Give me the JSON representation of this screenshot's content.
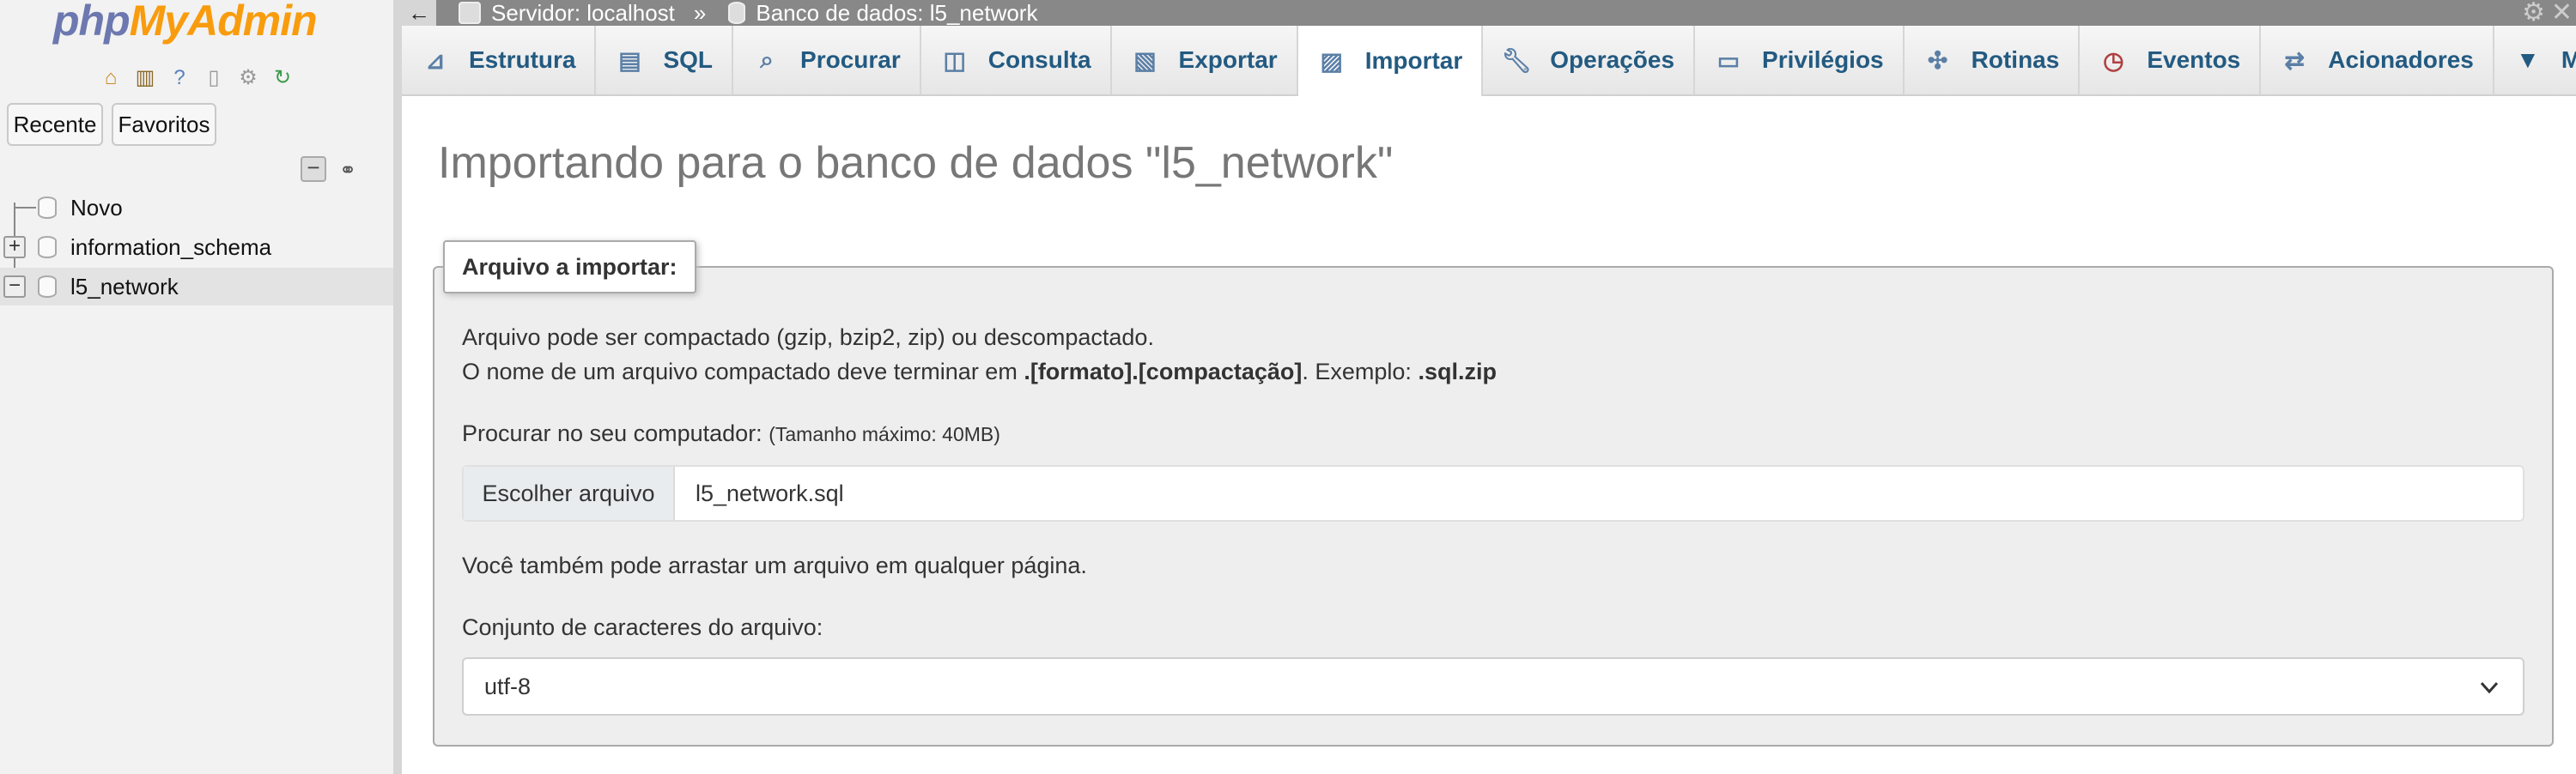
{
  "nav": {
    "logo": {
      "php": "php",
      "my": "My",
      "admin": "Admin"
    },
    "icons": [
      "home-icon",
      "logout-icon",
      "help-icon",
      "docs-icon",
      "settings-icon",
      "reload-icon"
    ],
    "tabs": {
      "recent": "Recente",
      "favorites": "Favoritos"
    },
    "tree": [
      {
        "label": "Novo"
      },
      {
        "label": "information_schema"
      },
      {
        "label": "l5_network"
      }
    ]
  },
  "topbar": {
    "back": "←",
    "server": "Servidor: localhost",
    "separator": "»",
    "database": "Banco de dados: l5_network"
  },
  "menu": {
    "tabs": [
      {
        "label": "Estrutura",
        "icon": "structure-icon"
      },
      {
        "label": "SQL",
        "icon": "sql-icon"
      },
      {
        "label": "Procurar",
        "icon": "search-icon"
      },
      {
        "label": "Consulta",
        "icon": "query-icon"
      },
      {
        "label": "Exportar",
        "icon": "export-icon"
      },
      {
        "label": "Importar",
        "icon": "import-icon",
        "active": true
      },
      {
        "label": "Operações",
        "icon": "wrench-icon"
      },
      {
        "label": "Privilégios",
        "icon": "privileges-icon"
      },
      {
        "label": "Rotinas",
        "icon": "routines-icon"
      },
      {
        "label": "Eventos",
        "icon": "events-icon"
      },
      {
        "label": "Acionadores",
        "icon": "triggers-icon"
      },
      {
        "label": "Mais",
        "icon": "caret-down-icon"
      }
    ]
  },
  "page": {
    "title": "Importando para o banco de dados \"l5_network\"",
    "legend": "Arquivo a importar:",
    "line1": "Arquivo pode ser compactado (gzip, bzip2, zip) ou descompactado.",
    "line2_pre": "O nome de um arquivo compactado deve terminar em ",
    "line2_bold": ".[formato].[compactação]",
    "line2_mid": ". Exemplo: ",
    "line2_example": ".sql.zip",
    "browse_label": "Procurar no seu computador:",
    "max_size": "(Tamanho máximo: 40MB)",
    "choose_button": "Escolher arquivo",
    "file_name": "l5_network.sql",
    "drag_hint": "Você também pode arrastar um arquivo em qualquer página.",
    "charset_label": "Conjunto de caracteres do arquivo:",
    "charset_value": "utf-8"
  },
  "colors": {
    "accent": "#235a81",
    "logo_php": "#6c78af",
    "logo_myadmin": "#f89c0e",
    "topbar": "#888888"
  }
}
